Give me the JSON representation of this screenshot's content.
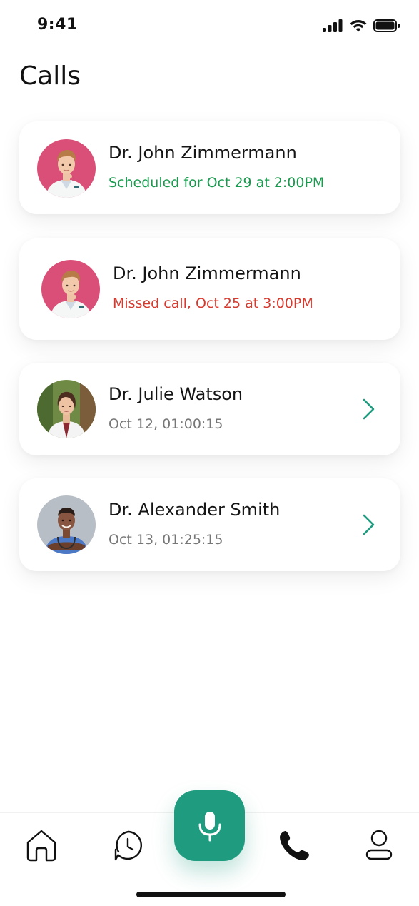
{
  "status_bar": {
    "time": "9:41",
    "icons": [
      "signal-icon",
      "wifi-icon",
      "battery-icon"
    ]
  },
  "page": {
    "title": "Calls"
  },
  "colors": {
    "accent": "#1f9c7f",
    "scheduled": "#1a9a4f",
    "missed": "#d63a2f",
    "muted": "#777777"
  },
  "calls": [
    {
      "name": "Dr. John Zimmermann",
      "subtitle": "Scheduled for Oct 29 at 2:00PM",
      "status": "scheduled",
      "avatar": "doctor-john-avatar"
    },
    {
      "name": "Dr. John Zimmermann",
      "subtitle": "Missed call, Oct 25 at 3:00PM",
      "status": "missed",
      "avatar": "doctor-john-avatar"
    },
    {
      "name": "Dr. Julie Watson",
      "subtitle": "Oct 12, 01:00:15",
      "status": "completed",
      "avatar": "doctor-julie-avatar",
      "chevron": "chevron-right-icon"
    },
    {
      "name": "Dr. Alexander Smith",
      "subtitle": "Oct 13, 01:25:15",
      "status": "completed",
      "avatar": "doctor-alexander-avatar",
      "chevron": "chevron-right-icon"
    }
  ],
  "tabbar": {
    "tabs": [
      "home-icon",
      "history-icon",
      "microphone-icon",
      "phone-icon",
      "profile-icon"
    ],
    "active": "phone-icon"
  }
}
